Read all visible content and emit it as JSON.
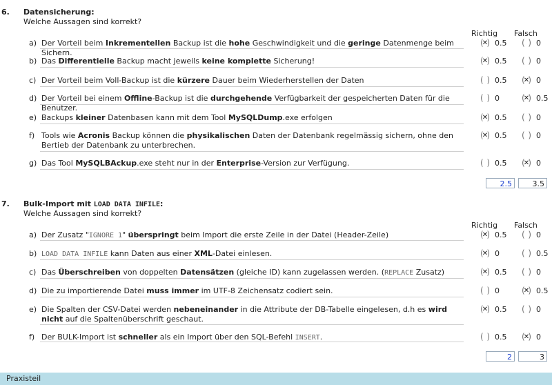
{
  "q6": {
    "num": "6.",
    "title": "Datensicherung:",
    "sub": "Welche Aussagen sind korrekt?",
    "col_true": "Richtig",
    "col_false": "Falsch",
    "items": [
      {
        "letter": "a)",
        "t_r": "✕",
        "t_rs": "0.5",
        "f_r": "",
        "f_rs": "0"
      },
      {
        "letter": "b)",
        "t_r": "✕",
        "t_rs": "0.5",
        "f_r": "",
        "f_rs": "0"
      },
      {
        "letter": "c)",
        "t_r": "",
        "t_rs": "0.5",
        "f_r": "✕",
        "f_rs": "0"
      },
      {
        "letter": "d)",
        "t_r": "",
        "t_rs": "0",
        "f_r": "✕",
        "f_rs": "0.5"
      },
      {
        "letter": "e)",
        "t_r": "✕",
        "t_rs": "0.5",
        "f_r": "",
        "f_rs": "0"
      },
      {
        "letter": "f)",
        "t_r": "✕",
        "t_rs": "0.5",
        "f_r": "",
        "f_rs": "0"
      },
      {
        "letter": "g)",
        "t_r": "",
        "t_rs": "0.5",
        "f_r": "✕",
        "f_rs": "0"
      }
    ],
    "score_achieved": "2.5",
    "score_max": "3.5"
  },
  "q7": {
    "num": "7.",
    "title_a": "Bulk-Import mit ",
    "title_code": "LOAD DATA INFILE",
    "title_b": ":",
    "sub": "Welche Aussagen sind korrekt?",
    "col_true": "Richtig",
    "col_false": "Falsch",
    "items": [
      {
        "letter": "a)",
        "t_r": "✕",
        "t_rs": "0.5",
        "f_r": "",
        "f_rs": "0"
      },
      {
        "letter": "b)",
        "t_r": "✕",
        "t_rs": "0",
        "f_r": "",
        "f_rs": "0.5"
      },
      {
        "letter": "c)",
        "t_r": "✕",
        "t_rs": "0.5",
        "f_r": "",
        "f_rs": "0"
      },
      {
        "letter": "d)",
        "t_r": "",
        "t_rs": "0",
        "f_r": "✕",
        "f_rs": "0.5"
      },
      {
        "letter": "e)",
        "t_r": "✕",
        "t_rs": "0.5",
        "f_r": "",
        "f_rs": "0"
      },
      {
        "letter": "f)",
        "t_r": "",
        "t_rs": "0.5",
        "f_r": "✕",
        "f_rs": "0"
      }
    ],
    "score_achieved": "2",
    "score_max": "3"
  },
  "text": {
    "q6a": [
      "Der Vorteil beim ",
      "Inkrementellen",
      " Backup ist die ",
      "hohe",
      " Geschwindigkeit und die ",
      "geringe",
      " Datenmenge beim Sichern."
    ],
    "q6b": [
      "Das ",
      "Differentielle",
      " Backup macht jeweils ",
      "keine komplette",
      " Sicherung!"
    ],
    "q6c": [
      "Der Vorteil beim Voll-Backup ist die ",
      "kürzere",
      " Dauer beim Wiederherstellen der Daten"
    ],
    "q6d": [
      "Der Vorteil bei einem ",
      "Offline",
      "-Backup ist die ",
      "durchgehende",
      " Verfügbarkeit der gespeicherten Daten für die Benutzer."
    ],
    "q6e": [
      "Backups ",
      "kleiner",
      " Datenbasen kann mit dem Tool ",
      "MySQLDump",
      ".exe erfolgen"
    ],
    "q6f": [
      "Tools wie ",
      "Acronis",
      " Backup können die ",
      "physikalischen",
      " Daten der Datenbank regelmässig sichern, ohne den Bertieb der Datenbank zu unterbrechen."
    ],
    "q6g": [
      "Das Tool ",
      "MySQLBAckup",
      ".exe steht nur in der ",
      "Enterprise",
      "-Version zur Verfügung."
    ],
    "q7a": [
      "Der Zusatz \"",
      "IGNORE 1",
      "\" ",
      "überspringt",
      " beim Import die erste Zeile in der Datei (Header-Zeile)"
    ],
    "q7b": [
      "LOAD DATA INFILE",
      " kann Daten aus einer ",
      "XML",
      "-Datei einlesen."
    ],
    "q7c": [
      "Das ",
      "Überschreiben",
      " von doppelten ",
      "Datensätzen",
      " (gleiche ID) kann zugelassen werden. (",
      "REPLACE",
      " Zusatz)"
    ],
    "q7d": [
      "Die zu importierende Datei ",
      "muss immer",
      " im UTF-8 Zeichensatz codiert sein."
    ],
    "q7e": [
      "Die Spalten der CSV-Datei werden ",
      "nebeneinander",
      " in die Attribute der DB-Tabelle eingelesen, d.h es ",
      "wird nicht",
      " auf die Spaltenüberschrift geschaut."
    ],
    "q7f": [
      "Der BULK-Import ist ",
      "schneller",
      " als ein Import über den SQL-Befehl ",
      "INSERT",
      "."
    ]
  },
  "footer": {
    "label": "Praxisteil"
  }
}
